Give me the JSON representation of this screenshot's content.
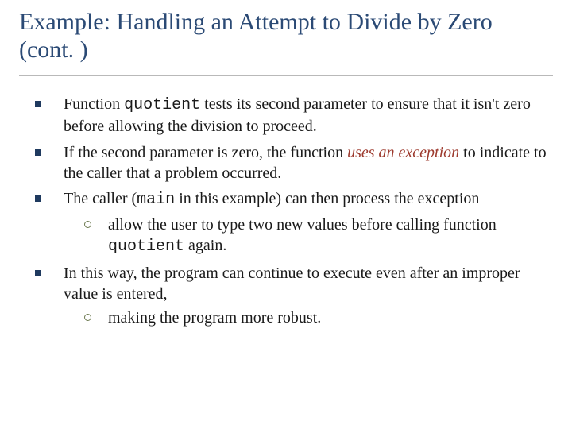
{
  "title": "Example: Handling an Attempt to Divide by Zero (cont. )",
  "b1_a": "Function ",
  "b1_code": "quotient",
  "b1_b": " tests its second parameter to ensure that it isn't zero before allowing the division to proceed.",
  "b2_a": "If the second parameter is zero, the function ",
  "b2_em": "uses an exception",
  "b2_b": " to indicate to the caller that a problem occurred.",
  "b3_a": "The caller (",
  "b3_code": "main",
  "b3_b": " in this example) can then process the exception",
  "b3_sub_a": "allow the user to type two new values before calling function ",
  "b3_sub_code": "quotient",
  "b3_sub_b": " again.",
  "b4": "In this way, the program can continue to execute even after an improper value is entered,",
  "b4_sub": "making the program more robust."
}
